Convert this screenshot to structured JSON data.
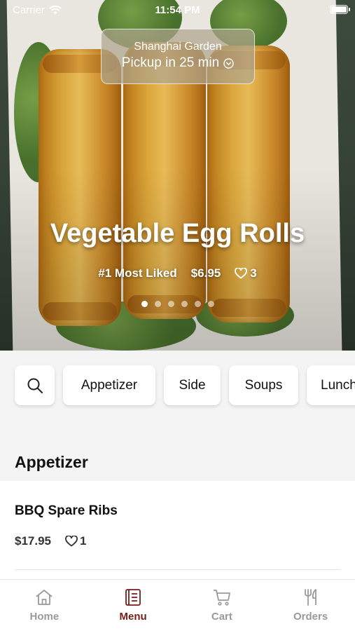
{
  "status_bar": {
    "carrier": "Carrier",
    "time": "11:54 PM",
    "battery_level": 1.0
  },
  "pickup": {
    "restaurant": "Shanghai Garden",
    "time_text": "Pickup in 25 min"
  },
  "hero": {
    "title": "Vegetable Egg Rolls",
    "rank": "#1 Most Liked",
    "price": "$6.95",
    "likes": "3",
    "slide_count": 6,
    "active_slide": 1
  },
  "categories": [
    "Appetizer",
    "Side",
    "Soups",
    "Lunch"
  ],
  "section": {
    "title": "Appetizer"
  },
  "items": [
    {
      "name": "BBQ Spare Ribs",
      "price": "$17.95",
      "likes": "1"
    }
  ],
  "tabs": [
    {
      "label": "Home",
      "icon": "home-icon",
      "active": false
    },
    {
      "label": "Menu",
      "icon": "menu-icon",
      "active": true
    },
    {
      "label": "Cart",
      "icon": "cart-icon",
      "active": false
    },
    {
      "label": "Orders",
      "icon": "orders-icon",
      "active": false
    }
  ],
  "colors": {
    "accent": "#7a1d1a",
    "tab_inactive": "#9a9a9a",
    "background": "#f4f4f4"
  }
}
